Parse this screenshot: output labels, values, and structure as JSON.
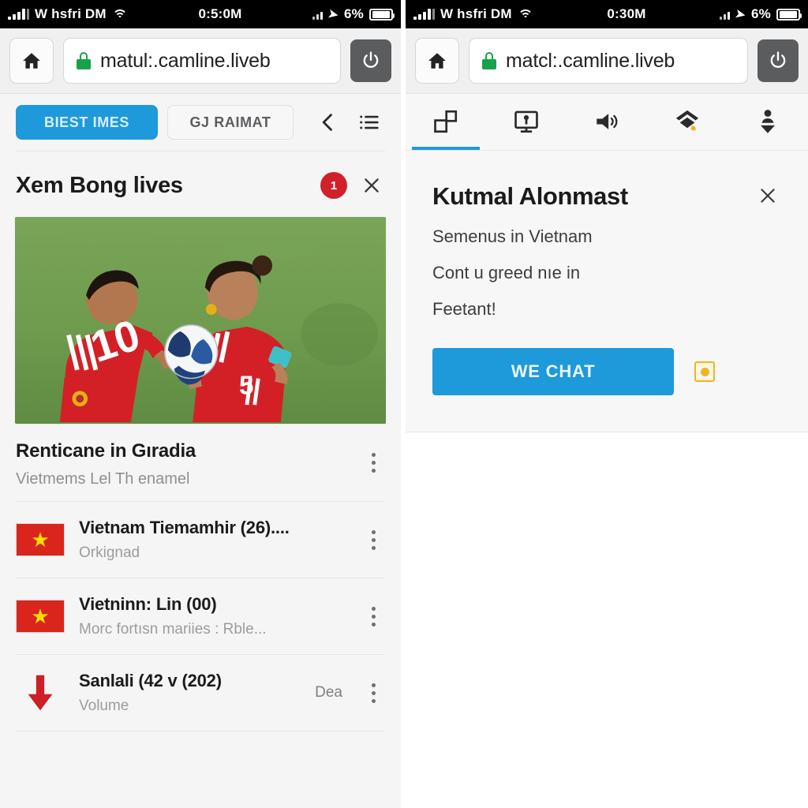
{
  "status_bar": {
    "carrier": "W hsfri DM",
    "time": "0:5:0M",
    "time_right": "0:30M",
    "battery_percent": "6%",
    "icons": [
      "signal-bars-icon",
      "wifi-icon",
      "signal-small-icon",
      "location-arrow-icon",
      "battery-icon"
    ]
  },
  "browser": {
    "home_icon": "home-icon",
    "lock_icon": "lock-icon",
    "url_left": "matul:.camline.liveb",
    "url_right": "matcl:.camline.liveb",
    "power_icon": "power-icon"
  },
  "left_panel": {
    "tabs": [
      {
        "label": "BIEST IMES",
        "active": true
      },
      {
        "label": "GJ RAIMAT",
        "active": false
      }
    ],
    "back_icon": "chevron-left-icon",
    "menu_icon": "list-menu-icon",
    "header": {
      "title": "Xem Bong lives",
      "badge_count": "1",
      "close_icon": "close-icon"
    },
    "hero": {
      "name": "football-players-photo",
      "alt": "Two football players in red jerseys holding a ball on a green pitch",
      "pitch_color": "#6f9b4e",
      "jersey_color": "#d32027"
    },
    "article": {
      "title": "Renticane in Gıradia",
      "subtitle": "Vietmems Lel Th enamel",
      "kebab_icon": "more-vertical-icon"
    },
    "list_items": [
      {
        "icon": "vietnam-flag-icon",
        "title": "Vietnam Tiemamhir (26)....",
        "subtitle": "Orkignad",
        "meta": "",
        "kebab_icon": "more-vertical-icon"
      },
      {
        "icon": "vietnam-flag-icon",
        "title": "Vietninn: Lin (00)",
        "subtitle": "Morc fortısn mariies : Rble...",
        "meta": "",
        "kebab_icon": "more-vertical-icon"
      },
      {
        "icon": "arrow-down-icon",
        "title": "Sanlali (42 v (202)",
        "subtitle": "Volume",
        "meta": "Dea",
        "kebab_icon": "more-vertical-icon"
      }
    ]
  },
  "right_panel": {
    "toolbar": [
      {
        "icon": "two-squares-icon",
        "active": true
      },
      {
        "icon": "monitor-icon",
        "active": false
      },
      {
        "icon": "speaker-icon",
        "active": false
      },
      {
        "icon": "diamond-stack-icon",
        "active": false
      },
      {
        "icon": "person-download-icon",
        "active": false
      }
    ],
    "dialog": {
      "title": "Kutmal Alonmast",
      "close_icon": "close-icon",
      "lines": [
        "Semenus in Vietnam",
        "Cont u greed nıe in",
        "Feetant!"
      ],
      "primary_button": "WE CHAT",
      "side_icon": "yellow-dot-icon"
    }
  },
  "colors": {
    "accent_blue": "#1e9ada",
    "badge_red": "#d0212b",
    "flag_red": "#da251d",
    "flag_star": "#ffdd00",
    "lock_green": "#17a24a",
    "panel_bg": "#f5f5f5",
    "card_bg": "#f7f7f7",
    "yellow": "#f0b429"
  }
}
